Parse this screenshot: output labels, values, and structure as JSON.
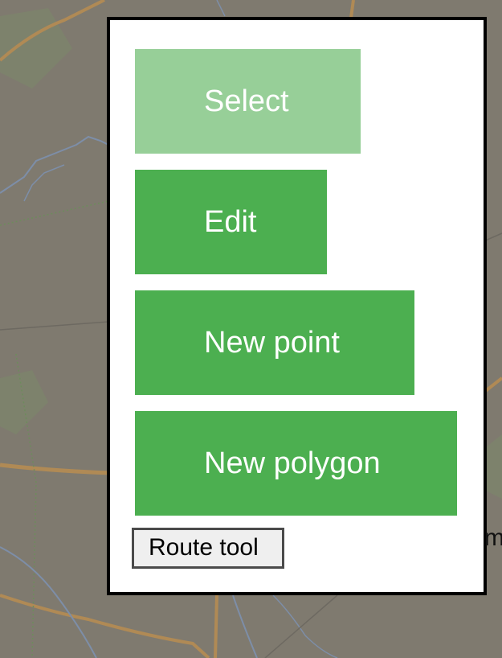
{
  "colors": {
    "map_background": "#7f7a6f",
    "road": "#b08a55",
    "water": "#7d8ea8",
    "panel_background": "#ffffff",
    "panel_border": "#000000",
    "button_green": "#4caf50",
    "button_active": "#97cf98"
  },
  "toolbar": {
    "tools": [
      {
        "label": "Select",
        "state": "active"
      },
      {
        "label": "Edit",
        "state": "normal"
      },
      {
        "label": "New point",
        "state": "normal"
      },
      {
        "label": "New polygon",
        "state": "normal"
      }
    ],
    "route_button_label": "Route tool"
  },
  "map": {
    "edge_label": "m"
  }
}
